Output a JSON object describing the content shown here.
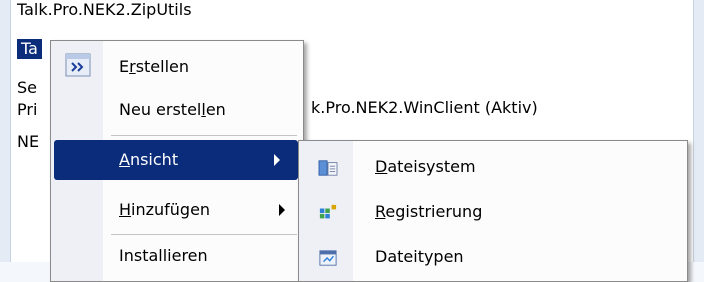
{
  "tree": {
    "line1": "Talk.Pro.NEK2.ZipUtils",
    "line2": "Ta",
    "line3": "Se",
    "line4": "Pri",
    "line5": "NE",
    "tail_text": "k.Pro.NEK2.WinClient (Aktiv)"
  },
  "context_menu": {
    "items": [
      {
        "label_pre": "E",
        "label_u": "r",
        "label_post": "stellen",
        "icon": "build-icon"
      },
      {
        "label_pre": "Neu erstel",
        "label_u": "l",
        "label_post": "en"
      },
      {
        "label_pre": "",
        "label_u": "A",
        "label_post": "nsicht",
        "has_submenu": true
      },
      {
        "label_pre": "",
        "label_u": "H",
        "label_post": "inzufügen",
        "has_submenu": true
      },
      {
        "label_pre": "Installieren",
        "label_u": "",
        "label_post": ""
      }
    ]
  },
  "submenu": {
    "items": [
      {
        "label_pre": "",
        "label_u": "D",
        "label_post": "ateisystem",
        "icon": "file-system-icon"
      },
      {
        "label_pre": "",
        "label_u": "R",
        "label_post": "egistrierung",
        "icon": "registry-icon"
      },
      {
        "label_pre": "Dateitypen",
        "label_u": "",
        "label_post": "",
        "icon": "file-types-icon"
      }
    ]
  },
  "colors": {
    "highlight": "#0b2c7a",
    "menu_bg": "#fcfcfc",
    "gutter": "#eef0f6"
  }
}
